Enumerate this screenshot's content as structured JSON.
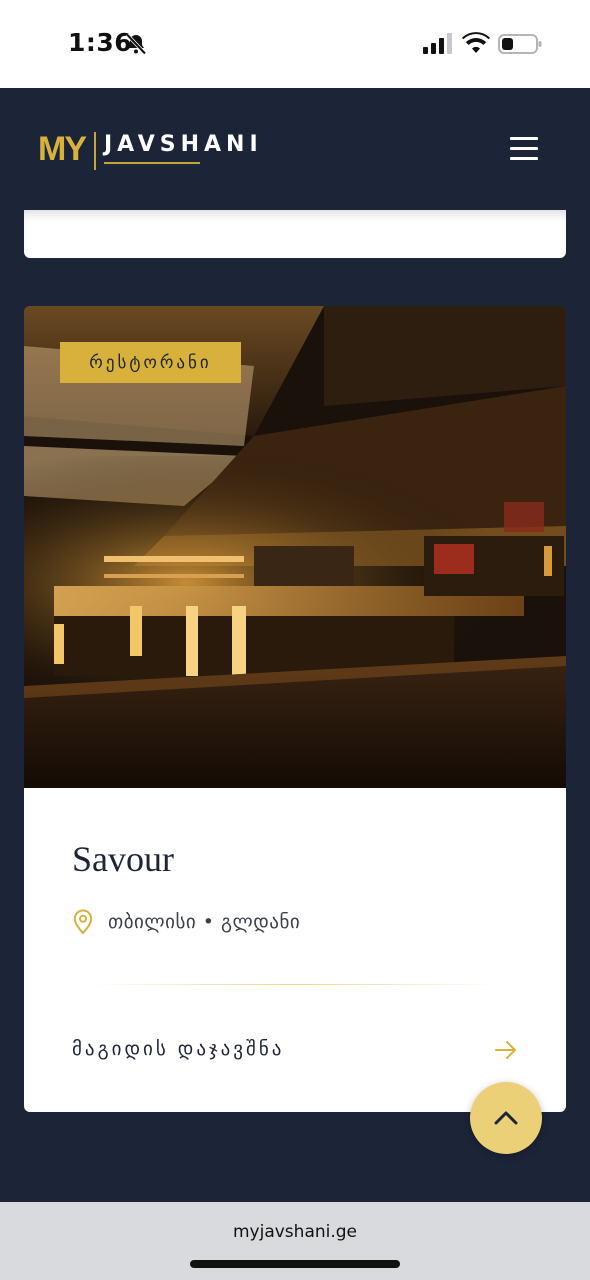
{
  "status_bar": {
    "time": "1:36",
    "icons": [
      "bell-slash-icon",
      "cellular-signal-icon",
      "wifi-icon",
      "battery-icon"
    ]
  },
  "header": {
    "logo_mark": "MY",
    "logo_text": "JAVSHANI",
    "menu_icon": "hamburger-menu-icon"
  },
  "restaurant_card": {
    "category": "რესტორანი",
    "name": "Savour",
    "location_icon": "map-pin-icon",
    "location": "თბილისი • გლდანი",
    "book_label": "მაგიდის დაჯავშნა",
    "book_icon": "arrow-right-icon"
  },
  "scroll_top_icon": "chevron-up-icon",
  "browser": {
    "url": "myjavshani.ge"
  },
  "colors": {
    "navy": "#1c2438",
    "gold": "#d7b13c",
    "scroll_button": "#ecd077",
    "card": "#ffffff"
  }
}
